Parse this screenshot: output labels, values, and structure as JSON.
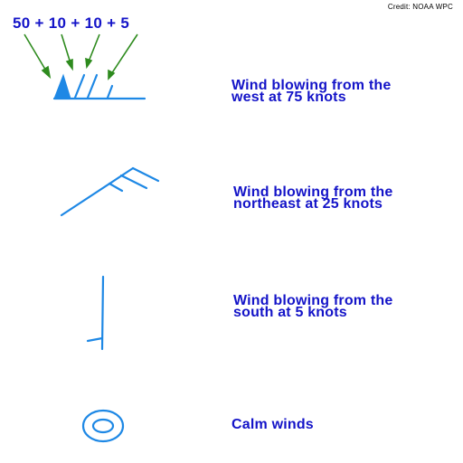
{
  "credit": "Credit: NOAA WPC",
  "formula": "50 + 10 + 10 + 5",
  "symbols": [
    {
      "id": "west",
      "description_line1": "Wind blowing from the",
      "description_line2": "west at 75 knots"
    },
    {
      "id": "northeast",
      "description_line1": "Wind blowing from the",
      "description_line2": "northeast at 25 knots"
    },
    {
      "id": "south",
      "description_line1": "Wind blowing from the",
      "description_line2": "south at 5 knots"
    },
    {
      "id": "calm",
      "description_line1": "Calm winds"
    }
  ],
  "colors": {
    "text": "#1414c8",
    "symbol": "#1e88e5",
    "arrow": "#2e8b1e",
    "credit": "#000000"
  }
}
